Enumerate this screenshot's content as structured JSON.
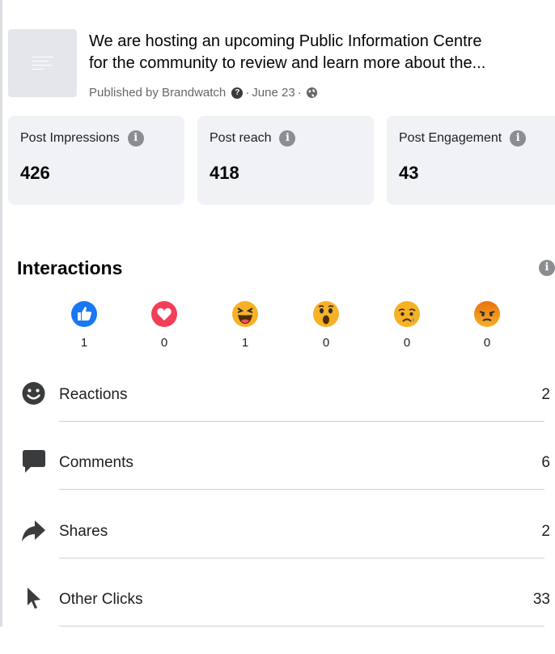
{
  "post": {
    "text_line1": "We are hosting an upcoming Public Information Centre",
    "text_line2": "for the community to review and learn more about the...",
    "publisher": "Published by Brandwatch",
    "separator": "·",
    "date": "June 23"
  },
  "stats": [
    {
      "label": "Post Impressions",
      "value": "426"
    },
    {
      "label": "Post reach",
      "value": "418"
    },
    {
      "label": "Post Engagement",
      "value": "43"
    }
  ],
  "interactions": {
    "title": "Interactions",
    "reactions": [
      {
        "type": "like",
        "count": "1",
        "color": "#1877f2"
      },
      {
        "type": "love",
        "count": "0",
        "color": "#f33e58"
      },
      {
        "type": "haha",
        "count": "1",
        "color": "#f7b125"
      },
      {
        "type": "wow",
        "count": "0",
        "color": "#f7b125"
      },
      {
        "type": "sad",
        "count": "0",
        "color": "#f7b125"
      },
      {
        "type": "angry",
        "count": "0",
        "color": "#e9710f"
      }
    ],
    "metrics": [
      {
        "label": "Reactions",
        "value": "2",
        "icon": "smiley-icon"
      },
      {
        "label": "Comments",
        "value": "6",
        "icon": "comment-icon"
      },
      {
        "label": "Shares",
        "value": "2",
        "icon": "share-arrow-icon"
      },
      {
        "label": "Other Clicks",
        "value": "33",
        "icon": "cursor-icon"
      }
    ]
  }
}
